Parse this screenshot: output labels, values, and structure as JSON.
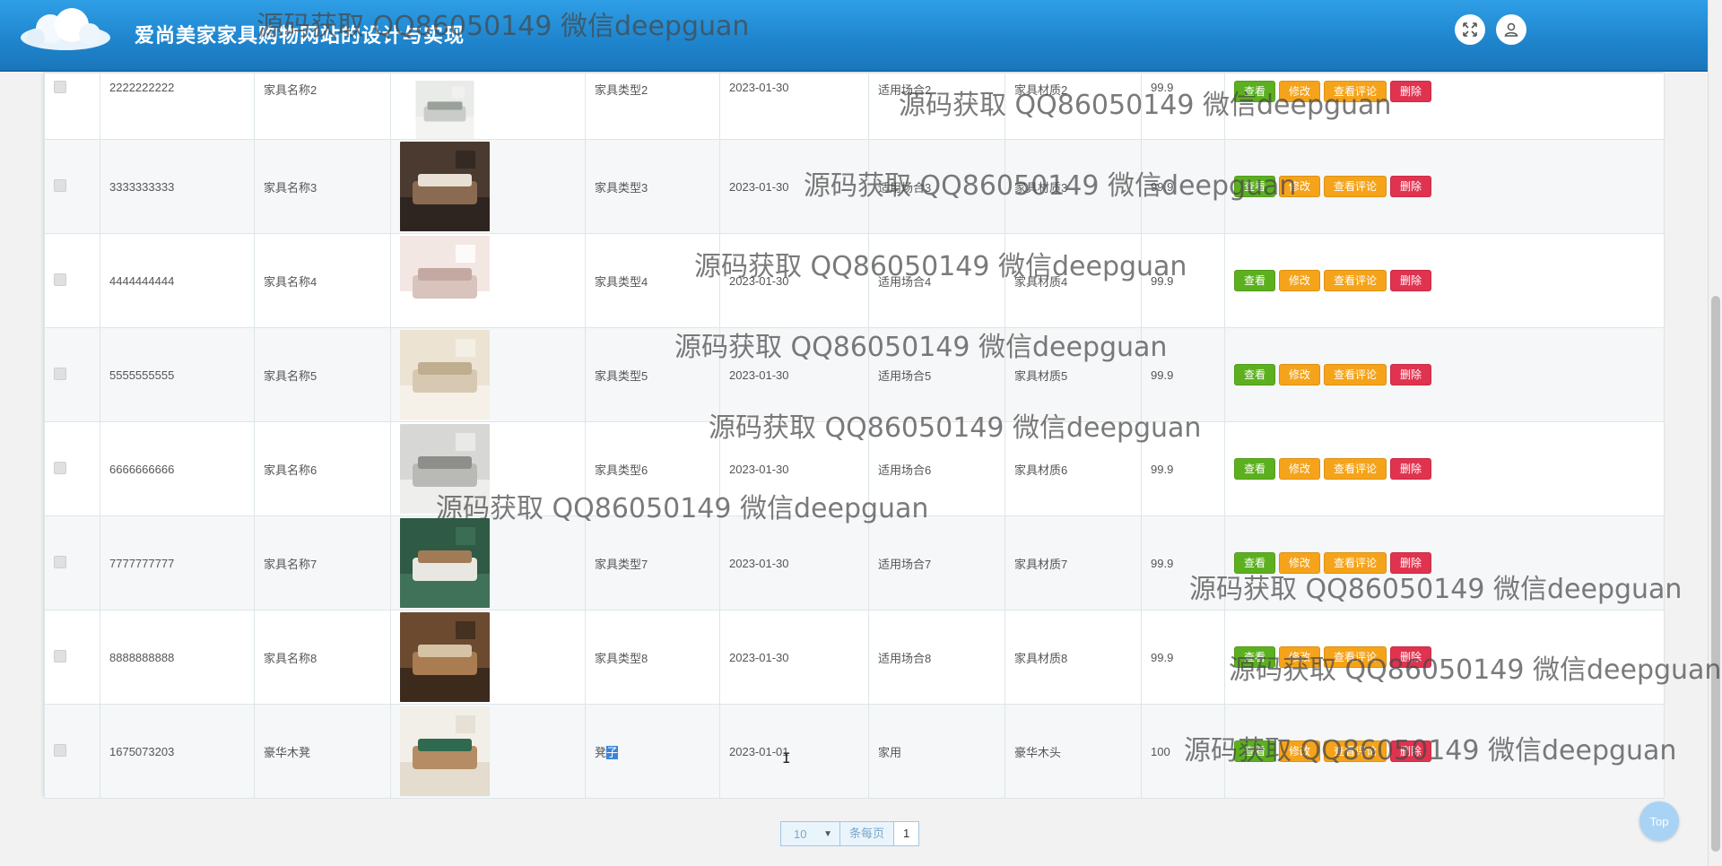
{
  "header": {
    "title": "爱尚美家家具购物网站的设计与实现",
    "fullscreen_icon": "expand-icon",
    "user_icon": "user-icon"
  },
  "rows": [
    {
      "id": "2222222222",
      "name": "家具名称2",
      "type": "家具类型2",
      "date": "2023-01-30",
      "scene": "适用场合2",
      "material": "家具材质2",
      "price": "99.9",
      "img": "sofa-gray"
    },
    {
      "id": "3333333333",
      "name": "家具名称3",
      "type": "家具类型3",
      "date": "2023-01-30",
      "scene": "适用场合3",
      "material": "家具材质3",
      "price": "99.9",
      "img": "bedroom-brown"
    },
    {
      "id": "4444444444",
      "name": "家具名称4",
      "type": "家具类型4",
      "date": "2023-01-30",
      "scene": "适用场合4",
      "material": "家具材质4",
      "price": "99.9",
      "img": "living-pink"
    },
    {
      "id": "5555555555",
      "name": "家具名称5",
      "type": "家具类型5",
      "date": "2023-01-30",
      "scene": "适用场合5",
      "material": "家具材质5",
      "price": "99.9",
      "img": "cabinet-cream"
    },
    {
      "id": "6666666666",
      "name": "家具名称6",
      "type": "家具类型6",
      "date": "2023-01-30",
      "scene": "适用场合6",
      "material": "家具材质6",
      "price": "99.9",
      "img": "sofa-round"
    },
    {
      "id": "7777777777",
      "name": "家具名称7",
      "type": "家具类型7",
      "date": "2023-01-30",
      "scene": "适用场合7",
      "material": "家具材质7",
      "price": "99.9",
      "img": "green-room"
    },
    {
      "id": "8888888888",
      "name": "家具名称8",
      "type": "家具类型8",
      "date": "2023-01-30",
      "scene": "适用场合8",
      "material": "家具材质8",
      "price": "99.9",
      "img": "wood-cabinet"
    },
    {
      "id": "1675073203",
      "name": "豪华木凳",
      "type_plain": "凳",
      "type_selected": "子",
      "date": "2023-01-01",
      "scene": "家用",
      "material": "豪华木头",
      "price": "100",
      "img": "wood-chair"
    }
  ],
  "actions": {
    "view": "查看",
    "edit": "修改",
    "review": "查看评论",
    "delete": "删除"
  },
  "pagination": {
    "page_size": "10",
    "per_page_label": "条每页",
    "page": "1"
  },
  "top_button": "Top",
  "watermark": "源码获取 QQ86050149 微信deepguan",
  "colors": {
    "header": "#1f86cf",
    "view": "#5cb020",
    "edit": "#f5a31a",
    "delete": "#e0334f"
  }
}
